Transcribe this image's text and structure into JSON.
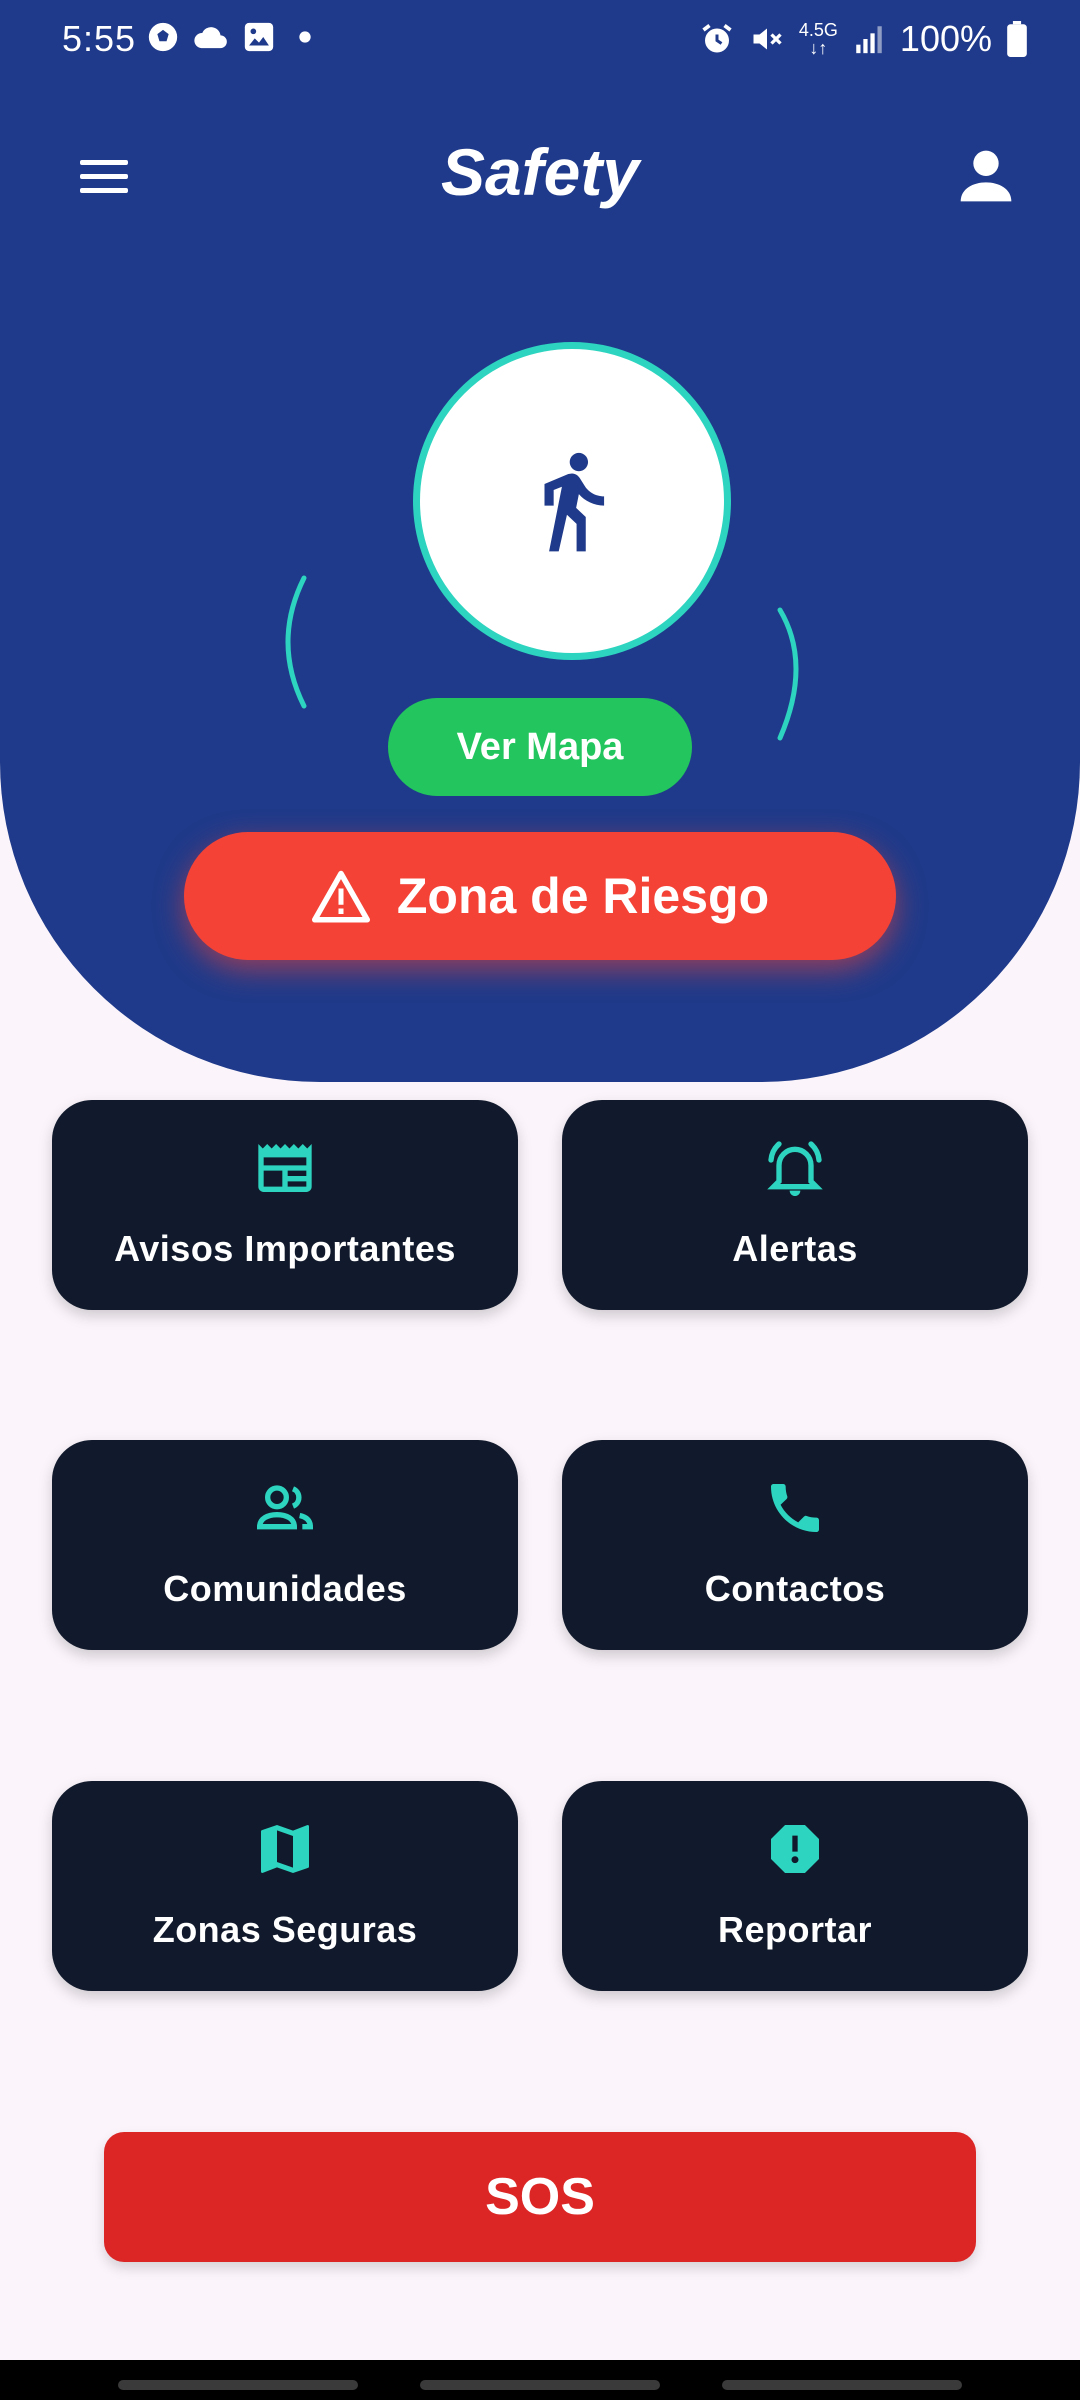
{
  "status_bar": {
    "time": "5:55",
    "battery_text": "100%",
    "network_label": "4.5G",
    "left_icons": [
      "soccer-icon",
      "cloud-icon",
      "image-icon",
      "dot-icon"
    ],
    "right_icons": [
      "alarm-icon",
      "mute-icon",
      "network-icon",
      "signal-icon",
      "battery-icon"
    ]
  },
  "app_bar": {
    "title": "Safety",
    "left_icon": "menu-icon",
    "right_icon": "profile-icon"
  },
  "hero": {
    "walker_icon": "walking-person-icon",
    "map_button_label": "Ver Mapa",
    "risk_button_label": "Zona de Riesgo",
    "risk_icon": "warning-icon"
  },
  "tiles": [
    {
      "label": "Avisos Importantes",
      "icon": "newspaper-icon"
    },
    {
      "label": "Alertas",
      "icon": "bell-ring-icon"
    },
    {
      "label": "Comunidades",
      "icon": "people-icon"
    },
    {
      "label": "Contactos",
      "icon": "phone-icon"
    },
    {
      "label": "Zonas Seguras",
      "icon": "map-icon"
    },
    {
      "label": "Reportar",
      "icon": "report-icon"
    }
  ],
  "sos_label": "SOS",
  "colors": {
    "primary": "#1f3a8a",
    "accent_teal": "#2dd4bf",
    "map_green": "#22c55e",
    "risk_red": "#f44336",
    "sos_red": "#dc2626",
    "tile_bg": "#111a2c",
    "page_bg": "#fbf5fb"
  }
}
